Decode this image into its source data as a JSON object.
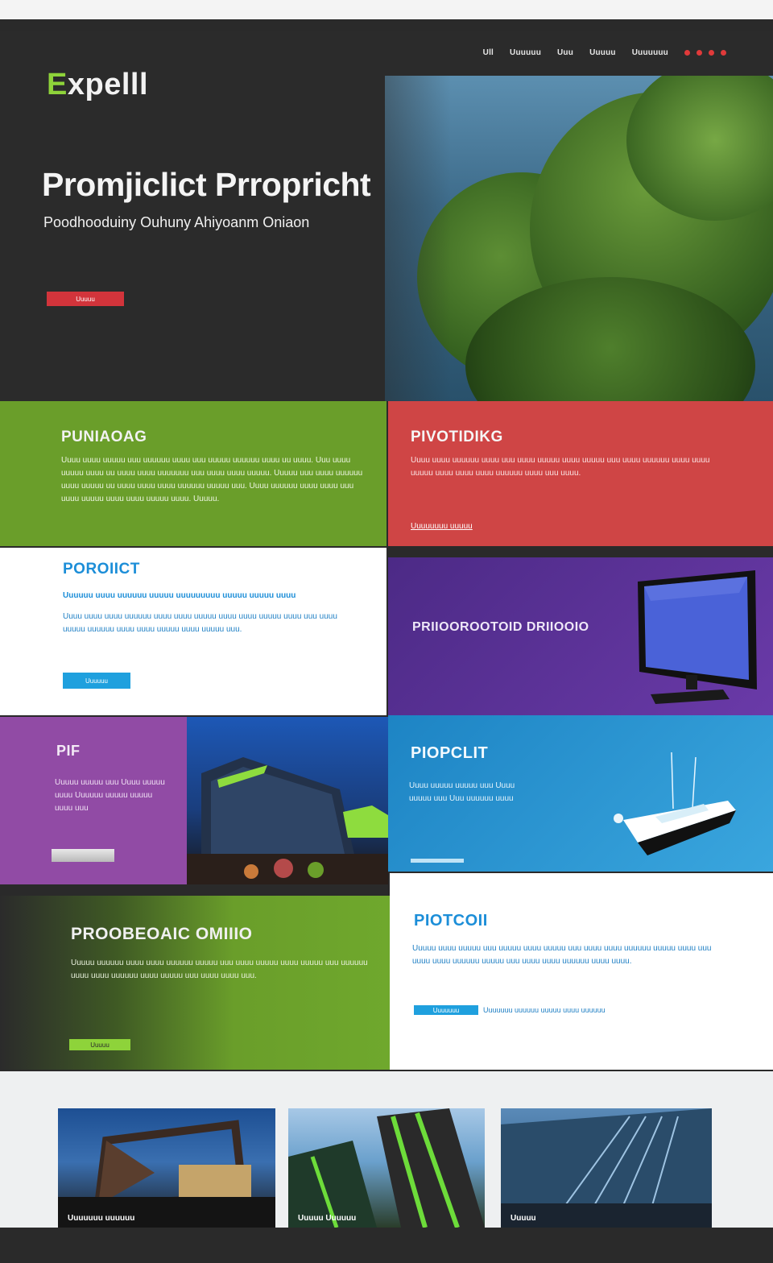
{
  "header": {
    "logo_first": "E",
    "logo_rest": "xpelll",
    "nav": [
      "Ull",
      "Uuuuuu",
      "Uuu",
      "Uuuuu",
      "Uuuuuuu"
    ]
  },
  "hero": {
    "title": "Promjiclict Prropricht",
    "subtitle": "Poodhooduiny Ouhuny Ahiyoanm Oniaon",
    "button": "Uuuuu"
  },
  "panels": {
    "green1": {
      "heading": "PUNIAOAG",
      "text": "Uuuu uuuu uuuuu uuu uuuuuu uuuu uuu uuuuu uuuuuu uuuu uu uuuu. Uuu uuuu uuuuu uuuu uu uuuu uuuu uuuuuuu uuu uuuu uuuu uuuuu. Uuuuu uuu uuuu uuuuuu uuuu uuuuu uu uuuu uuuu uuuu uuuuuu uuuuu uuu. Uuuu uuuuuu uuuu uuuu uuu uuuu uuuuu uuuu uuuu uuuuu uuuu. Uuuuu."
    },
    "red": {
      "heading": "PIVOTIDIKG",
      "text": "Uuuu uuuu uuuuuu uuuu uuu uuuu uuuuu uuuu uuuuu uuu uuuu uuuuuu uuuu uuuu uuuuu uuuu uuuu uuuu uuuuuu uuuu uuu uuuu.",
      "link": "Uuuuuuuu uuuuu"
    },
    "white1": {
      "heading": "POROIICT",
      "text1": "Uuuuuu uuuu uuuuuu uuuuu uuuuuuuuu uuuuu uuuuu uuuu",
      "text2": "Uuuu uuuu uuuu uuuuuu uuuu uuuu uuuuu uuuu uuuu uuuuu uuuu uuu uuuu uuuuu uuuuuu uuuu uuuu uuuuu uuuu uuuuu uuu.",
      "button": "Uuuuuu"
    },
    "purple": {
      "heading": "PRIIOOROOTOID  DRIIOOIO"
    },
    "violet": {
      "heading": "PIF",
      "text": "Uuuuu uuuuu uuu Uuuu uuuuu uuuu Uuuuuu uuuuu uuuuu uuuu uuu"
    },
    "blue": {
      "heading": "PIOPCLIT",
      "text": "Uuuu uuuuu uuuuu uuu Uuuu uuuuu uuu Uuu uuuuuu uuuu"
    },
    "green2": {
      "heading": "PROOBEOAIC OMIIIO",
      "text": "Uuuuu uuuuuu uuuu uuuu uuuuuu uuuuu uuu uuuu uuuuu uuuu uuuuu uuu uuuuuu uuuu uuuu uuuuuu uuuu uuuuu uuu uuuu uuuu uuu.",
      "button": "Uuuuu"
    },
    "white2": {
      "heading": "PIOTCOII",
      "text": "Uuuuu uuuu uuuuu uuu uuuuu uuuu uuuuu uuu uuuu uuuu uuuuuu uuuuu uuuu uuu uuuu uuuu uuuuuu uuuuu uuu uuuu uuuu uuuuuu uuuu uuuu.",
      "button": "Uuuuuuu",
      "link": "Uuuuuuu uuuuuu uuuuu uuuu uuuuuu"
    }
  },
  "gallery": [
    "Uuuuuuu uuuuuu",
    "Uuuuu Uuuuuu",
    "Uuuuu"
  ],
  "colors": {
    "green": "#6a9e2a",
    "red": "#cf4545",
    "blue": "#1d84c4",
    "purple": "#5a2f96",
    "violet": "#914ba5",
    "accent_red": "#d2343b",
    "accent_cyan": "#1fa0de",
    "dark": "#2b2b2b"
  }
}
